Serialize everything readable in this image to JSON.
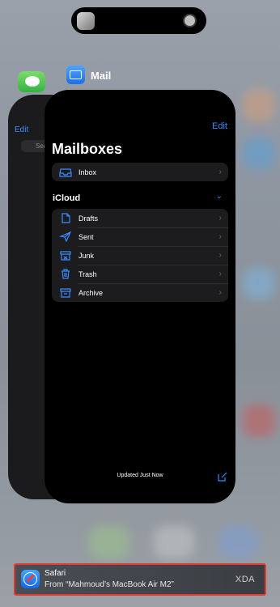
{
  "status": {
    "dynamic_island": "now-playing"
  },
  "switcher": {
    "front_app_name": "Mail",
    "back_app_name": "Messages",
    "back_app_edit": "Edit",
    "back_app_search_placeholder": "Search"
  },
  "mail": {
    "edit_label": "Edit",
    "title": "Mailboxes",
    "top_items": [
      {
        "label": "Inbox",
        "icon": "inbox-icon"
      }
    ],
    "account_header": "iCloud",
    "account_items": [
      {
        "label": "Drafts",
        "icon": "drafts-icon"
      },
      {
        "label": "Sent",
        "icon": "sent-icon"
      },
      {
        "label": "Junk",
        "icon": "junk-icon"
      },
      {
        "label": "Trash",
        "icon": "trash-icon"
      },
      {
        "label": "Archive",
        "icon": "archive-icon"
      }
    ],
    "footer_status": "Updated Just Now"
  },
  "notification": {
    "app": "Safari",
    "subtitle": "From “Mahmoud’s MacBook Air M2”",
    "watermark": "XDA"
  },
  "colors": {
    "accent_blue": "#3a8cff",
    "highlight_border": "#e0392f"
  }
}
